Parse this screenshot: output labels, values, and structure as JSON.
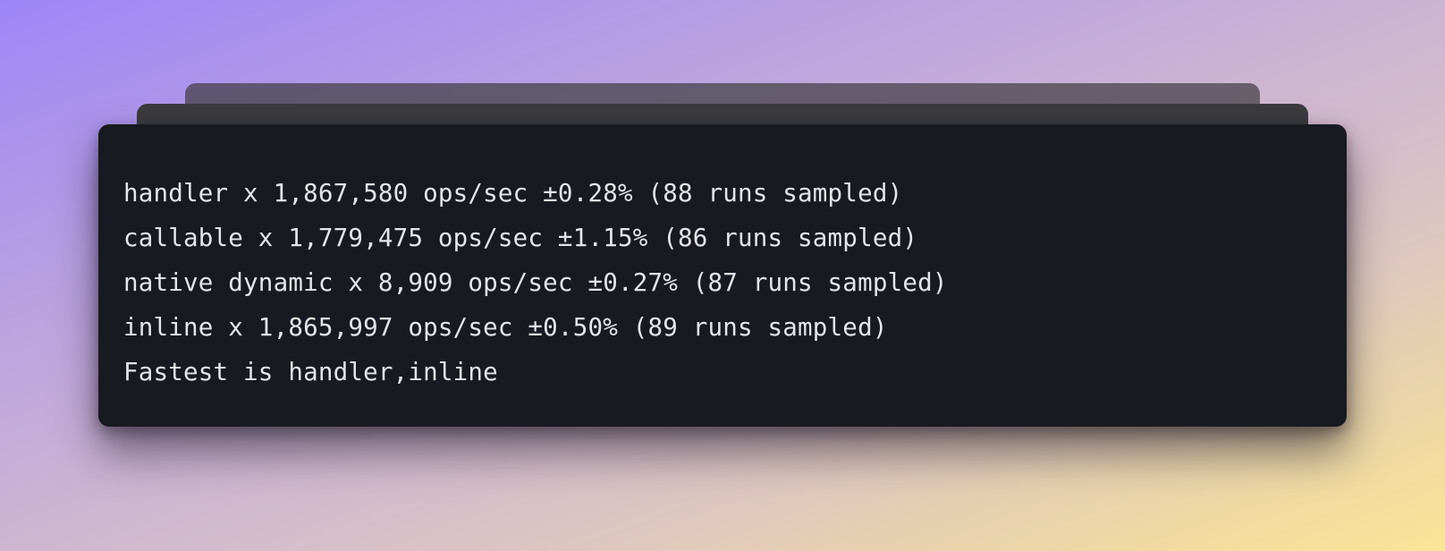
{
  "terminal": {
    "lines": [
      "handler x 1,867,580 ops/sec ±0.28% (88 runs sampled)",
      "callable x 1,779,475 ops/sec ±1.15% (86 runs sampled)",
      "native dynamic x 8,909 ops/sec ±0.27% (87 runs sampled)",
      "inline x 1,865,997 ops/sec ±0.50% (89 runs sampled)",
      "Fastest is handler,inline"
    ]
  },
  "colors": {
    "terminal_bg": "#171a20",
    "text": "#e3e5ea",
    "gradient_start": "#9d86f7",
    "gradient_end": "#fbe596"
  }
}
